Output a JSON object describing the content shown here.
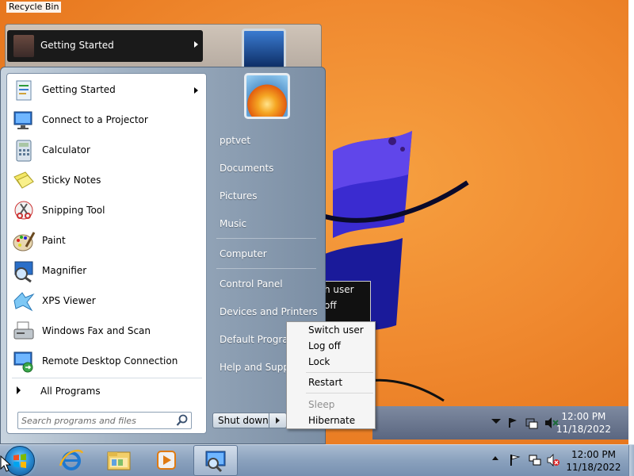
{
  "desktop": {
    "recycle_bin_label": "Recycle Bin"
  },
  "ghost": {
    "item_label": "Getting Started",
    "popup_lines": [
      "h user",
      "off"
    ],
    "clock_time": "12:00 PM",
    "clock_date": "11/18/2022"
  },
  "start_menu": {
    "programs": [
      {
        "label": "Getting Started",
        "icon": "getting-started-icon",
        "has_submenu": true
      },
      {
        "label": "Connect to a Projector",
        "icon": "projector-icon"
      },
      {
        "label": "Calculator",
        "icon": "calculator-icon"
      },
      {
        "label": "Sticky Notes",
        "icon": "sticky-notes-icon"
      },
      {
        "label": "Snipping Tool",
        "icon": "snipping-tool-icon"
      },
      {
        "label": "Paint",
        "icon": "paint-icon"
      },
      {
        "label": "Magnifier",
        "icon": "magnifier-icon"
      },
      {
        "label": "XPS Viewer",
        "icon": "xps-viewer-icon"
      },
      {
        "label": "Windows Fax and Scan",
        "icon": "fax-scan-icon"
      },
      {
        "label": "Remote Desktop Connection",
        "icon": "remote-desktop-icon"
      }
    ],
    "all_programs_label": "All Programs",
    "search_placeholder": "Search programs and files",
    "right_items": [
      "pptvet",
      "Documents",
      "Pictures",
      "Music",
      "Computer",
      "Control Panel",
      "Devices and Printers",
      "Default Programs",
      "Help and Support"
    ],
    "shutdown_label": "Shut down"
  },
  "shutdown_menu": {
    "items": [
      {
        "label": "Switch user",
        "enabled": true
      },
      {
        "label": "Log off",
        "enabled": true
      },
      {
        "label": "Lock",
        "enabled": true
      },
      {
        "label": "Restart",
        "enabled": true
      },
      {
        "label": "Sleep",
        "enabled": false
      },
      {
        "label": "Hibernate",
        "enabled": true
      }
    ]
  },
  "taskbar": {
    "pinned": [
      "internet-explorer-icon",
      "windows-explorer-icon",
      "media-player-icon",
      "control-panel-icon"
    ],
    "active_index": 3,
    "clock_time": "12:00 PM",
    "clock_date": "11/18/2022",
    "tray_icons": [
      "action-center-flag-icon",
      "network-icon",
      "volume-muted-icon"
    ]
  },
  "colors": {
    "desktop_orange": "#f08a30",
    "menu_blue": "#7b8ea4",
    "taskbar_blue": "#8aa1bd"
  }
}
